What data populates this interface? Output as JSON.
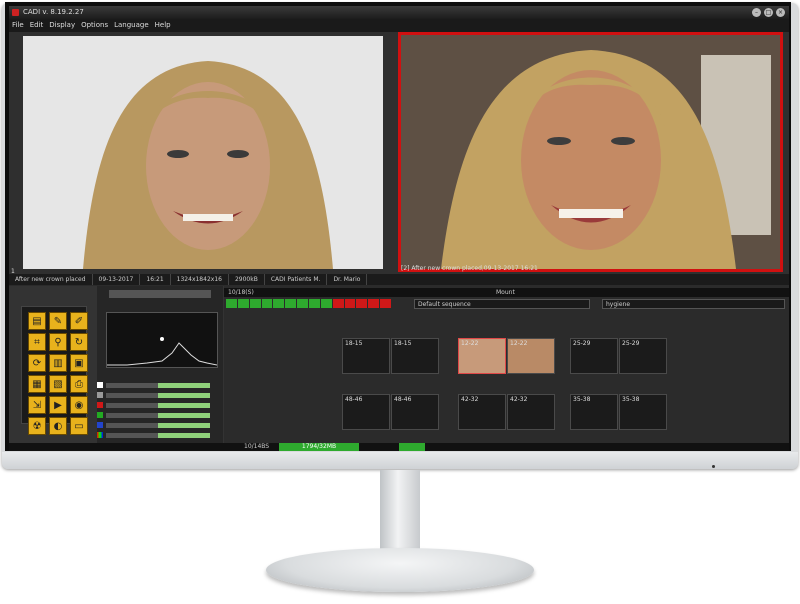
{
  "window": {
    "title": "CADI v. 8.19.2.27"
  },
  "menu": [
    "File",
    "Edit",
    "Display",
    "Options",
    "Language",
    "Help"
  ],
  "photos": {
    "left_number": "1",
    "right_caption": "[2] After new crown placed,09-13-2017 16:21"
  },
  "infobar": [
    "After new crown placed",
    "09-13-2017",
    "16:21",
    "1324x1842x16",
    "2900kB",
    "CADI Patients M.",
    "Dr. Mario"
  ],
  "workspace": {
    "counter": "10/18(S)",
    "mount": "Mount",
    "sequence": "Default sequence",
    "hygiene": "hygiene"
  },
  "progress": {
    "green": 9,
    "red": 5
  },
  "slots": [
    {
      "label_a": "18-15",
      "label_b": "18-15"
    },
    {
      "label_a": "12-22",
      "label_b": "12-22"
    },
    {
      "label_a": "25-29",
      "label_b": "25-29"
    },
    {
      "label_a": "48-46",
      "label_b": "48-46"
    },
    {
      "label_a": "42-32",
      "label_b": "42-32"
    },
    {
      "label_a": "35-38",
      "label_b": "35-38"
    }
  ],
  "status": {
    "left": "10/14BS",
    "mid": "1794/32MB"
  },
  "colors": {
    "accent": "#d01010",
    "tool": "#e8b21c",
    "ok": "#2eaa2e"
  }
}
